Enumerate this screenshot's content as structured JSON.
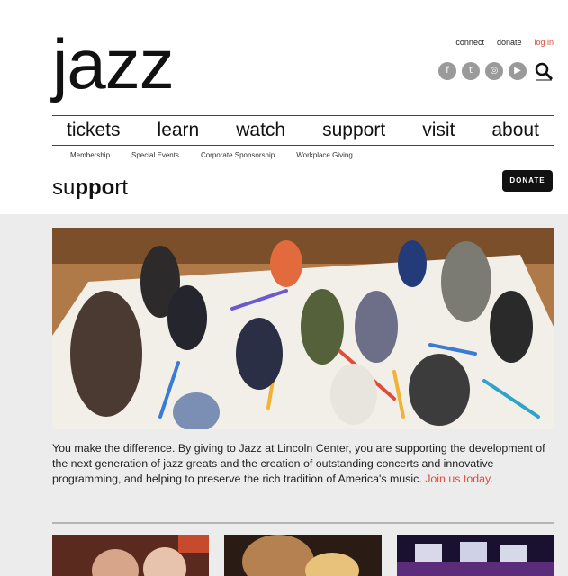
{
  "brand": {
    "logo_text": "jazz"
  },
  "utility_links": {
    "connect": "connect",
    "donate": "donate",
    "login": "log in"
  },
  "social": {
    "icons": [
      "facebook-icon",
      "twitter-icon",
      "instagram-icon",
      "youtube-icon",
      "search-icon"
    ]
  },
  "main_nav": [
    "tickets",
    "learn",
    "watch",
    "support",
    "visit",
    "about"
  ],
  "sub_nav": [
    "Membership",
    "Special Events",
    "Corporate Sponsorship",
    "Workplace Giving"
  ],
  "page": {
    "title_prefix": "su",
    "title_bold": "ppo",
    "title_suffix": "rt",
    "donate_button": "DONATE"
  },
  "content": {
    "description": "You make the difference. By giving to Jazz at Lincoln Center, you are supporting the development of the next generation of jazz greats and the creation of outstanding concerts and innovative programming, and helping to preserve the rich tradition of America's music.",
    "cta_link": "Join us today",
    "cta_suffix": "."
  },
  "colors": {
    "accent": "#e24b3c",
    "band": "#ececec",
    "button": "#111111"
  }
}
